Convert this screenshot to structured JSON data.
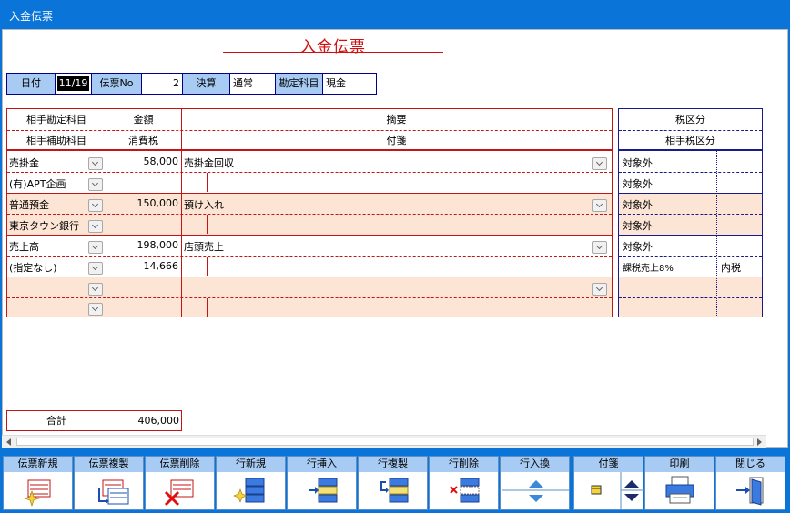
{
  "window": {
    "title": "入金伝票"
  },
  "doc_title": "入金伝票",
  "header": {
    "date_label": "日付",
    "date_value": "11/19",
    "slip_no_label": "伝票No",
    "slip_no_value": "2",
    "settlement_label": "決算",
    "settlement_value": "通常",
    "account_label": "勘定科目",
    "account_value": "現金"
  },
  "columns": {
    "partner_account": "相手勘定科目",
    "partner_sub": "相手補助科目",
    "amount": "金額",
    "tax": "消費税",
    "summary": "摘要",
    "memo": "付箋",
    "tax_class": "税区分",
    "partner_tax_class": "相手税区分"
  },
  "rows": [
    {
      "account": "売掛金",
      "sub": "(有)APT企画",
      "amount": "58,000",
      "tax": "",
      "summary": "売掛金回収",
      "tax_class": "対象外",
      "tax_class2": "対象外",
      "incl": ""
    },
    {
      "account": "普通預金",
      "sub": "東京タウン銀行",
      "amount": "150,000",
      "tax": "",
      "summary": "預け入れ",
      "tax_class": "対象外",
      "tax_class2": "対象外",
      "incl": ""
    },
    {
      "account": "売上高",
      "sub": "(指定なし)",
      "amount": "198,000",
      "tax": "14,666",
      "summary": "店頭売上",
      "tax_class": "対象外",
      "tax_class2": "課税売上8%",
      "incl": "内税"
    },
    {
      "account": "",
      "sub": "",
      "amount": "",
      "tax": "",
      "summary": "",
      "tax_class": "",
      "tax_class2": "",
      "incl": ""
    }
  ],
  "total": {
    "label": "合計",
    "value": "406,000"
  },
  "toolbar": [
    {
      "label": "伝票新規",
      "icon": "new-slip-icon"
    },
    {
      "label": "伝票複製",
      "icon": "copy-slip-icon"
    },
    {
      "label": "伝票削除",
      "icon": "delete-slip-icon"
    },
    {
      "label": "行新規",
      "icon": "new-row-icon"
    },
    {
      "label": "行挿入",
      "icon": "insert-row-icon"
    },
    {
      "label": "行複製",
      "icon": "copy-row-icon"
    },
    {
      "label": "行削除",
      "icon": "delete-row-icon"
    },
    {
      "label": "行入換",
      "icon": "swap-rows-icon"
    },
    {
      "label": "付箋",
      "icon": "sticky-note-icon"
    },
    {
      "label": "印刷",
      "icon": "printer-icon"
    },
    {
      "label": "閉じる",
      "icon": "close-door-icon"
    }
  ],
  "colors": {
    "chrome": "#0a74d8",
    "label_bg": "#a7cbf3",
    "grid_red": "#c41414",
    "shade": "#fce5d4",
    "title_red": "#d01010"
  }
}
